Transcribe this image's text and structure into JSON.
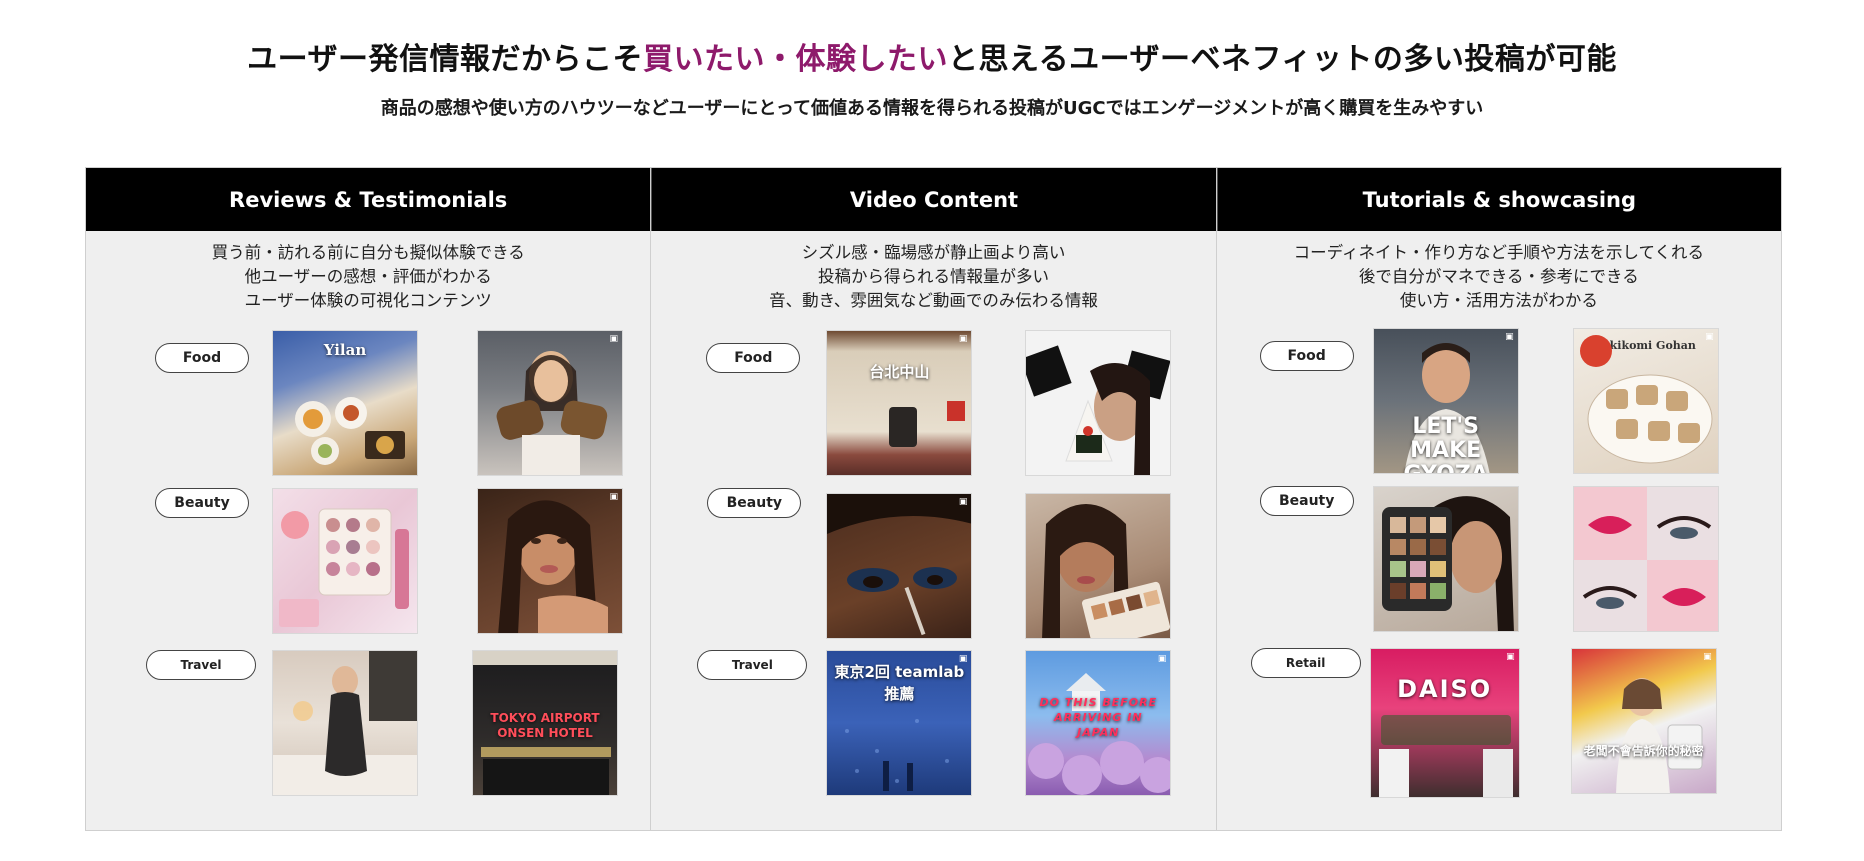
{
  "header": {
    "title_before": "ユーザー発信情報だからこそ",
    "title_accent": "買いたい・体験したい",
    "title_after": "と思えるユーザーベネフィットの多い投稿が可能",
    "subtitle": "商品の感想や使い方のハウツーなどユーザーにとって価値ある情報を得られる投稿がUGCではエンゲージメントが高く購買を生みやすい",
    "accent_color": "#8e1a6b"
  },
  "columns": [
    {
      "heading": "Reviews & Testimonials",
      "desc": [
        "買う前・訪れる前に自分も擬似体験できる",
        "他ユーザーの感想・評価がわかる",
        "ユーザー体験の可視化コンテンツ"
      ],
      "rows": [
        {
          "tag": "Food",
          "captions": [
            "Yilan",
            ""
          ]
        },
        {
          "tag": "Beauty",
          "captions": [
            "",
            ""
          ]
        },
        {
          "tag": "Travel",
          "captions": [
            "",
            "TOKYO AIRPORT ONSEN HOTEL"
          ]
        }
      ]
    },
    {
      "heading": "Video Content",
      "desc": [
        "シズル感・臨場感が静止画より高い",
        "投稿から得られる情報量が多い",
        "音、動き、雰囲気など動画でのみ伝わる情報"
      ],
      "rows": [
        {
          "tag": "Food",
          "captions": [
            "台北中山",
            ""
          ]
        },
        {
          "tag": "Beauty",
          "captions": [
            "",
            ""
          ]
        },
        {
          "tag": "Travel",
          "captions": [
            "東京2回 teamlab推薦",
            "DO THIS BEFORE ARRIVING IN JAPAN"
          ]
        }
      ]
    },
    {
      "heading": "Tutorials & showcasing",
      "desc": [
        "コーディネイト・作り方など手順や方法を示してくれる",
        "後で自分がマネできる・参考にできる",
        "使い方・活用方法がわかる"
      ],
      "rows": [
        {
          "tag": "Food",
          "captions": [
            "LET'S MAKE GYOZA",
            "Takikomi Gohan"
          ]
        },
        {
          "tag": "Beauty",
          "captions": [
            "",
            ""
          ]
        },
        {
          "tag": "Retail",
          "captions": [
            "DAISO",
            "老闆不會告訴你的秘密"
          ]
        }
      ]
    }
  ]
}
